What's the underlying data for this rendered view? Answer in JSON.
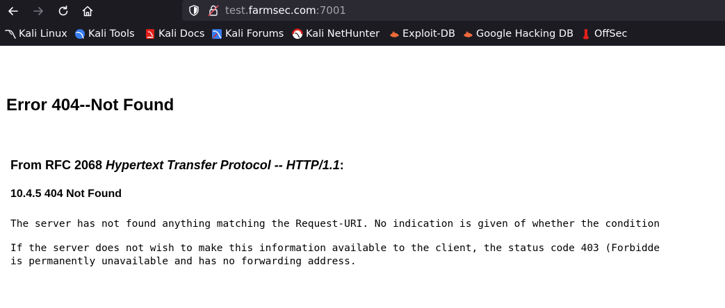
{
  "browser": {
    "url": {
      "prefix": "test.",
      "host": "farmsec.com",
      "port": ":7001"
    },
    "bookmarks": [
      {
        "label": "Kali Linux",
        "icon": "kali-dragon-icon"
      },
      {
        "label": "Kali Tools",
        "icon": "kali-tools-icon"
      },
      {
        "label": "Kali Docs",
        "icon": "kali-docs-icon"
      },
      {
        "label": "Kali Forums",
        "icon": "kali-forums-icon"
      },
      {
        "label": "Kali NetHunter",
        "icon": "kali-nethunter-icon"
      },
      {
        "label": "Exploit-DB",
        "icon": "exploit-db-icon"
      },
      {
        "label": "Google Hacking DB",
        "icon": "ghdb-icon"
      },
      {
        "label": "OffSec",
        "icon": "offsec-icon"
      }
    ],
    "colors": {
      "toolbar_bg": "#1c1b22",
      "urlbar_bg": "#2b2a33",
      "text": "#fbfbfe",
      "muted": "#a4a3ab"
    }
  },
  "page": {
    "title": "Error 404--Not Found",
    "rfc_heading": {
      "pre": "From RFC 2068 ",
      "italic": "Hypertext Transfer Protocol -- HTTP/1.1",
      "post": ":"
    },
    "section": "10.4.5 404 Not Found",
    "paragraph_1": "The server has not found anything matching the Request-URI. No indication is given of whether the condition",
    "paragraph_2_line_1": "If the server does not wish to make this information available to the client, the status code 403 (Forbidde",
    "paragraph_2_line_2": "is permanently unavailable and has no forwarding address."
  }
}
